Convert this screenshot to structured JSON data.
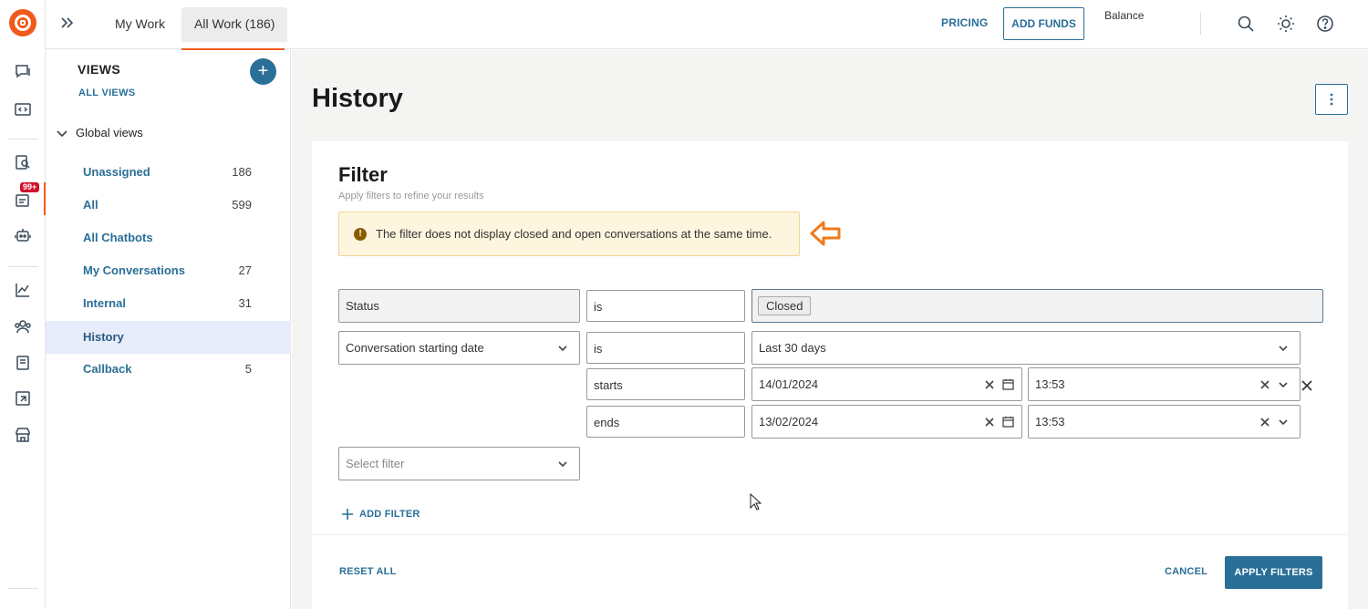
{
  "topbar": {
    "tabs": [
      {
        "label": "My Work"
      },
      {
        "label": "All Work (186)"
      }
    ],
    "pricing": "PRICING",
    "add_funds": "ADD FUNDS",
    "balance": "Balance"
  },
  "rail": {
    "badge": "99+"
  },
  "views": {
    "title": "VIEWS",
    "all_views": "ALL VIEWS",
    "add": "+",
    "group": "Global views",
    "items": [
      {
        "label": "Unassigned",
        "count": "186"
      },
      {
        "label": "All",
        "count": "599"
      },
      {
        "label": "All Chatbots",
        "count": ""
      },
      {
        "label": "My Conversations",
        "count": "27"
      },
      {
        "label": "Internal",
        "count": "31"
      },
      {
        "label": "History",
        "count": ""
      },
      {
        "label": "Callback",
        "count": "5"
      }
    ]
  },
  "main": {
    "title": "History",
    "filter": {
      "title": "Filter",
      "subtitle": "Apply filters to refine your results",
      "alert": "The filter does not display closed and open conversations at the same time.",
      "rows": {
        "status_field": "Status",
        "status_op": "is",
        "status_value": "Closed",
        "date_field": "Conversation starting date",
        "date_op": "is",
        "date_value": "Last 30 days",
        "starts_label": "starts",
        "starts_date": "14/01/2024",
        "starts_time": "13:53",
        "ends_label": "ends",
        "ends_date": "13/02/2024",
        "ends_time": "13:53",
        "select_placeholder": "Select filter"
      },
      "add_filter": "ADD FILTER",
      "reset_all": "RESET ALL",
      "cancel": "CANCEL",
      "apply": "APPLY FILTERS"
    }
  },
  "colors": {
    "accent": "#2a6f97",
    "brand": "#f05a1a",
    "alert_bg": "#fdf5de",
    "active_view_bg": "#e6ecfa"
  }
}
